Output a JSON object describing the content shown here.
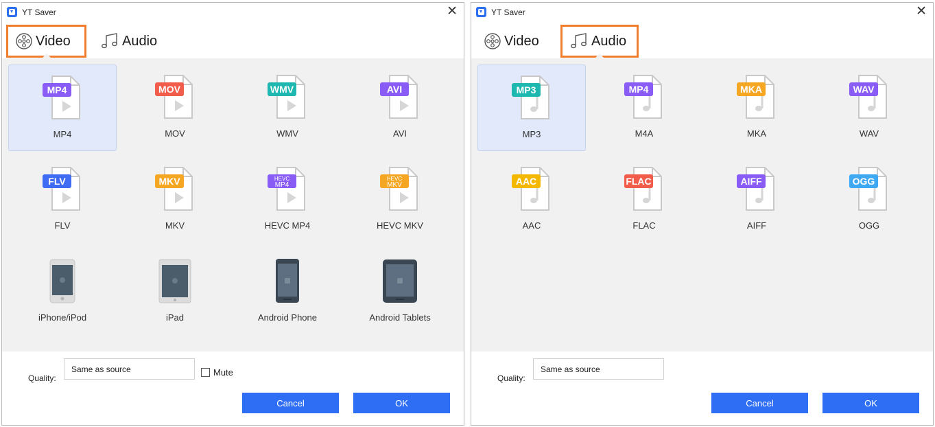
{
  "left_dialog": {
    "title": "YT Saver",
    "tabs": [
      {
        "label": "Video",
        "icon": "film-reel-icon",
        "selected": true
      },
      {
        "label": "Audio",
        "icon": "music-note-icon",
        "selected": false
      }
    ],
    "formats": [
      {
        "label": "MP4",
        "badge": "MP4",
        "badge_color": "#8a5cf6",
        "type": "video",
        "selected": true
      },
      {
        "label": "MOV",
        "badge": "MOV",
        "badge_color": "#f25c4a",
        "type": "video"
      },
      {
        "label": "WMV",
        "badge": "WMV",
        "badge_color": "#1fb8b0",
        "type": "video"
      },
      {
        "label": "AVI",
        "badge": "AVI",
        "badge_color": "#8a5cf6",
        "type": "video"
      },
      {
        "label": "FLV",
        "badge": "FLV",
        "badge_color": "#3f6cf2",
        "type": "video"
      },
      {
        "label": "MKV",
        "badge": "MKV",
        "badge_color": "#f5a623",
        "type": "video"
      },
      {
        "label": "HEVC MP4",
        "badge": "HEVC MP4",
        "badge_color": "#8a5cf6",
        "type": "video"
      },
      {
        "label": "HEVC MKV",
        "badge": "HEVC MKV",
        "badge_color": "#f5a623",
        "type": "video"
      },
      {
        "label": "iPhone/iPod",
        "type": "iphone"
      },
      {
        "label": "iPad",
        "type": "ipad"
      },
      {
        "label": "Android Phone",
        "type": "android-phone"
      },
      {
        "label": "Android Tablets",
        "type": "android-tablet"
      }
    ],
    "quality_label": "Quality:",
    "quality_value": "Same as source",
    "mute_label": "Mute",
    "mute_checked": false,
    "cancel_label": "Cancel",
    "ok_label": "OK"
  },
  "right_dialog": {
    "title": "YT Saver",
    "tabs": [
      {
        "label": "Video",
        "icon": "film-reel-icon",
        "selected": false
      },
      {
        "label": "Audio",
        "icon": "music-note-icon",
        "selected": true
      }
    ],
    "formats": [
      {
        "label": "MP3",
        "badge": "MP3",
        "badge_color": "#1fb8b0",
        "type": "audio",
        "selected": true
      },
      {
        "label": "M4A",
        "badge": "MP4",
        "badge_color": "#8a5cf6",
        "type": "audio"
      },
      {
        "label": "MKA",
        "badge": "MKA",
        "badge_color": "#f5a623",
        "type": "audio"
      },
      {
        "label": "WAV",
        "badge": "WAV",
        "badge_color": "#8a5cf6",
        "type": "audio"
      },
      {
        "label": "AAC",
        "badge": "AAC",
        "badge_color": "#f5b800",
        "type": "audio"
      },
      {
        "label": "FLAC",
        "badge": "FLAC",
        "badge_color": "#f25c4a",
        "type": "audio"
      },
      {
        "label": "AIFF",
        "badge": "AIFF",
        "badge_color": "#8a5cf6",
        "type": "audio"
      },
      {
        "label": "OGG",
        "badge": "OGG",
        "badge_color": "#3fa8f2",
        "type": "audio"
      }
    ],
    "quality_label": "Quality:",
    "quality_value": "Same as source",
    "cancel_label": "Cancel",
    "ok_label": "OK"
  },
  "colors": {
    "accent": "#2e6ef5",
    "tab_highlight": "#f37d2e",
    "selection_bg": "#e1e9fa",
    "grid_bg": "#f1f1f1"
  }
}
